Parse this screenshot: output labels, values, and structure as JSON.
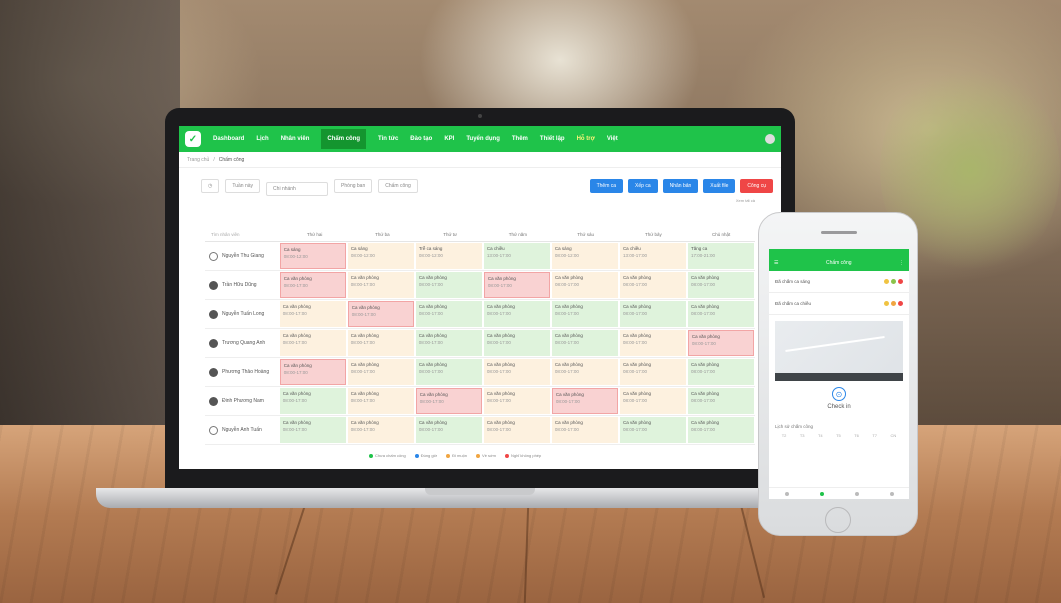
{
  "colors": {
    "brand": "#1fc34a",
    "primary_button": "#2a86e8",
    "danger_button": "#ef4646"
  },
  "nav": {
    "items": [
      "Dashboard",
      "Lịch",
      "Nhân viên",
      "Chấm công",
      "Tin tức",
      "Đào tạo",
      "KPI",
      "Tuyển dụng",
      "Thêm",
      "Thiết lập",
      "Hỗ trợ",
      "Việt"
    ],
    "active_index": 3,
    "highlight_index": 10
  },
  "breadcrumb": {
    "parent": "Trang chủ",
    "current": "Chấm công"
  },
  "toolbar": {
    "week_select": "Tuần này",
    "branch_select": "Chi nhánh",
    "department_select": "Phòng ban",
    "shift_select": "Chấm công",
    "buttons": [
      "Thêm ca",
      "Xếp ca",
      "Nhân bản",
      "Xuất file",
      "Công cụ"
    ],
    "hint": "Xem tất cả"
  },
  "grid": {
    "search_placeholder": "Tìm nhân viên",
    "days": [
      "Thứ hai",
      "Thứ ba",
      "Thứ tư",
      "Thứ năm",
      "Thứ sáu",
      "Thứ bảy",
      "Chủ nhật"
    ],
    "rows": [
      {
        "name": "Nguyễn Thu Giang",
        "avatar": "outline",
        "cells": [
          [
            "r",
            "Ca sáng",
            "08:00-12:00"
          ],
          [
            "y",
            "Ca sáng",
            "08:00-12:00"
          ],
          [
            "y",
            "Trễ ca sáng",
            "08:00-12:00"
          ],
          [
            "g",
            "Ca chiều",
            "13:00-17:00"
          ],
          [
            "y",
            "Ca sáng",
            "08:00-12:00"
          ],
          [
            "y",
            "Ca chiều",
            "13:00-17:00"
          ],
          [
            "g",
            "Tăng ca",
            "17:00-21:00"
          ]
        ]
      },
      {
        "name": "Trần Hữu Dũng",
        "avatar": "solid",
        "cells": [
          [
            "r",
            "Ca văn phòng",
            "08:00-17:00"
          ],
          [
            "y",
            "Ca văn phòng",
            "08:00-17:00"
          ],
          [
            "g",
            "Ca văn phòng",
            "08:00-17:00"
          ],
          [
            "r",
            "Ca văn phòng",
            "08:00-17:00"
          ],
          [
            "y",
            "Ca văn phòng",
            "08:00-17:00"
          ],
          [
            "y",
            "Ca văn phòng",
            "08:00-17:00"
          ],
          [
            "g",
            "Ca văn phòng",
            "08:00-17:00"
          ]
        ]
      },
      {
        "name": "Nguyễn Tuấn Long",
        "avatar": "solid",
        "cells": [
          [
            "y",
            "Ca văn phòng",
            "08:00-17:00"
          ],
          [
            "r",
            "Ca văn phòng",
            "08:00-17:00"
          ],
          [
            "g",
            "Ca văn phòng",
            "08:00-17:00"
          ],
          [
            "g",
            "Ca văn phòng",
            "08:00-17:00"
          ],
          [
            "g",
            "Ca văn phòng",
            "08:00-17:00"
          ],
          [
            "g",
            "Ca văn phòng",
            "08:00-17:00"
          ],
          [
            "g",
            "Ca văn phòng",
            "08:00-17:00"
          ]
        ]
      },
      {
        "name": "Trương Quang Anh",
        "avatar": "solid",
        "cells": [
          [
            "y",
            "Ca văn phòng",
            "08:00-17:00"
          ],
          [
            "y",
            "Ca văn phòng",
            "08:00-17:00"
          ],
          [
            "g",
            "Ca văn phòng",
            "08:00-17:00"
          ],
          [
            "g",
            "Ca văn phòng",
            "08:00-17:00"
          ],
          [
            "g",
            "Ca văn phòng",
            "08:00-17:00"
          ],
          [
            "y",
            "Ca văn phòng",
            "08:00-17:00"
          ],
          [
            "r",
            "Ca văn phòng",
            "08:00-17:00"
          ]
        ]
      },
      {
        "name": "Phương Thảo Hoàng",
        "avatar": "solid",
        "cells": [
          [
            "r",
            "Ca văn phòng",
            "08:00-17:00"
          ],
          [
            "y",
            "Ca văn phòng",
            "08:00-17:00"
          ],
          [
            "g",
            "Ca văn phòng",
            "08:00-17:00"
          ],
          [
            "y",
            "Ca văn phòng",
            "08:00-17:00"
          ],
          [
            "y",
            "Ca văn phòng",
            "08:00-17:00"
          ],
          [
            "y",
            "Ca văn phòng",
            "08:00-17:00"
          ],
          [
            "g",
            "Ca văn phòng",
            "08:00-17:00"
          ]
        ]
      },
      {
        "name": "Đinh Phương Nam",
        "avatar": "solid",
        "cells": [
          [
            "g",
            "Ca văn phòng",
            "08:00-17:00"
          ],
          [
            "y",
            "Ca văn phòng",
            "08:00-17:00"
          ],
          [
            "r",
            "Ca văn phòng",
            "08:00-17:00"
          ],
          [
            "y",
            "Ca văn phòng",
            "08:00-17:00"
          ],
          [
            "r",
            "Ca văn phòng",
            "08:00-17:00"
          ],
          [
            "y",
            "Ca văn phòng",
            "08:00-17:00"
          ],
          [
            "g",
            "Ca văn phòng",
            "08:00-17:00"
          ]
        ]
      },
      {
        "name": "Nguyễn Anh Tuấn",
        "avatar": "outline",
        "cells": [
          [
            "g",
            "Ca văn phòng",
            "08:00-17:00"
          ],
          [
            "y",
            "Ca văn phòng",
            "08:00-17:00"
          ],
          [
            "g",
            "Ca văn phòng",
            "08:00-17:00"
          ],
          [
            "y",
            "Ca văn phòng",
            "08:00-17:00"
          ],
          [
            "y",
            "Ca văn phòng",
            "08:00-17:00"
          ],
          [
            "g",
            "Ca văn phòng",
            "08:00-17:00"
          ],
          [
            "g",
            "Ca văn phòng",
            "08:00-17:00"
          ]
        ]
      }
    ]
  },
  "legend": [
    {
      "label": "Chưa chấm công",
      "color": "#1fc34a"
    },
    {
      "label": "Đúng giờ",
      "color": "#2a86e8"
    },
    {
      "label": "Đi muộn",
      "color": "#f0a541"
    },
    {
      "label": "Về sớm",
      "color": "#f0a541"
    },
    {
      "label": "Nghỉ không phép",
      "color": "#ef4646"
    }
  ],
  "phone": {
    "title": "Chấm công",
    "status_rows": [
      {
        "label": "Đã chấm ca sáng",
        "dots": [
          "#f0c341",
          "#8bc34a",
          "#ef4646"
        ]
      },
      {
        "label": "Đã chấm ca chiều",
        "dots": [
          "#f0c341",
          "#f0a541",
          "#ef4646"
        ]
      }
    ],
    "checkin_label": "Check in",
    "history_label": "Lịch sử chấm công",
    "calendar_days": [
      "T2",
      "T3",
      "T4",
      "T5",
      "T6",
      "T7",
      "CN"
    ]
  }
}
